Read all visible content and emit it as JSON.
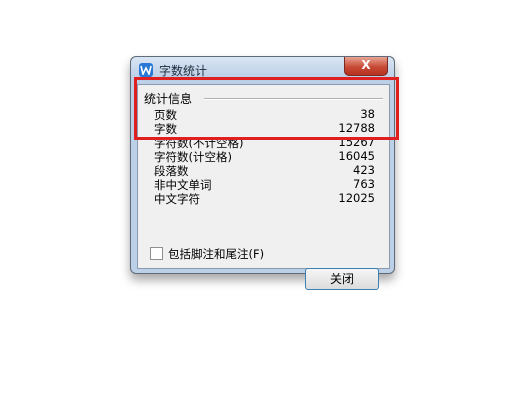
{
  "window": {
    "title": "字数统计",
    "close_glyph": "X"
  },
  "group": {
    "header": "统计信息"
  },
  "stats": [
    {
      "label": "页数",
      "value": "38"
    },
    {
      "label": "字数",
      "value": "12788"
    },
    {
      "label": "字符数(不计空格)",
      "value": "15267"
    },
    {
      "label": "字符数(计空格)",
      "value": "16045"
    },
    {
      "label": "段落数",
      "value": "423"
    },
    {
      "label": "非中文单词",
      "value": "763"
    },
    {
      "label": "中文字符",
      "value": "12025"
    }
  ],
  "include_footnotes": {
    "label": "包括脚注和尾注(F)",
    "checked": false
  },
  "buttons": {
    "close": "关闭"
  },
  "colors": {
    "highlight": "#e02020",
    "close_button": "#c74a36",
    "app_icon": "#2a78d6"
  }
}
